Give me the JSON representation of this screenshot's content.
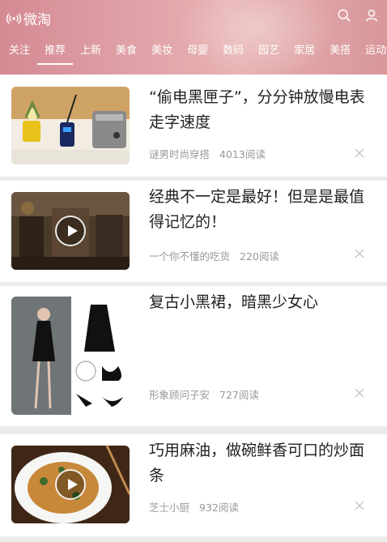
{
  "app": {
    "title": "微淘"
  },
  "tabs": [
    "关注",
    "推荐",
    "上新",
    "美食",
    "美妆",
    "母婴",
    "数码",
    "园艺",
    "家居",
    "美搭",
    "运动"
  ],
  "active_tab": 1,
  "articles": [
    {
      "title": "“偷电黑匣子”，分分钟放慢电表走字速度",
      "author": "谜男时尚穿搭",
      "reads": "4013阅读",
      "video": false
    },
    {
      "title": "经典不一定是最好！但是是最值得记忆的！",
      "author": "一个你不懂的吃货",
      "reads": "220阅读",
      "video": true
    },
    {
      "title": "复古小黑裙，暗黑少女心",
      "author": "形象顾问子安",
      "reads": "727阅读",
      "video": false
    },
    {
      "title": "巧用麻油，做碗鲜香可口的炒面条",
      "author": "芝士小厨",
      "reads": "932阅读",
      "video": true
    }
  ],
  "icons": {
    "brand": "radio-waves-icon",
    "search": "search-icon",
    "user": "user-icon",
    "close": "close-icon",
    "play": "play-icon"
  }
}
